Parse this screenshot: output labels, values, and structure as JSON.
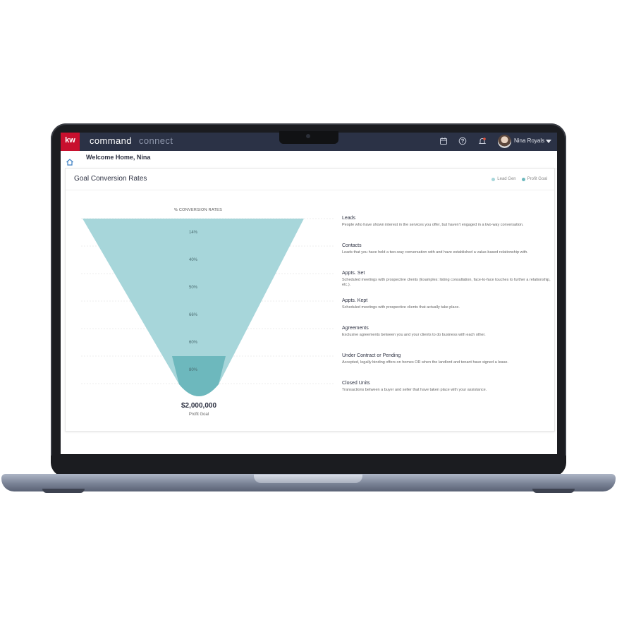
{
  "app": {
    "logo_text": "kw",
    "brand_primary": "command",
    "brand_secondary": "connect",
    "user_name": "Nina Royals",
    "colors": {
      "topbar": "#2b3246",
      "logo_red": "#c8102e",
      "funnel_light": "#a7d6da",
      "funnel_dark": "#6db8bd"
    }
  },
  "topbar_icons": [
    "calendar-icon",
    "help-icon",
    "bell-icon"
  ],
  "header": {
    "welcome": "Welcome Home, Nina"
  },
  "card": {
    "title": "Goal Conversion Rates",
    "legend": [
      {
        "label": "Lead Gen",
        "color": "#a7d6da"
      },
      {
        "label": "Profit Goal",
        "color": "#6db8bd"
      }
    ],
    "funnel_heading": "% CONVERSION RATES",
    "rates": [
      "14%",
      "40%",
      "50%",
      "66%",
      "60%",
      "80%"
    ],
    "profit_amount": "$2,000,000",
    "profit_label": "Profit Goal"
  },
  "stages": [
    {
      "title": "Leads",
      "desc": "People who have shown interest in the services you offer, but haven't engaged in a two-way conversation."
    },
    {
      "title": "Contacts",
      "desc": "Leads that you have held a two-way conversation with and have established a value-based relationship with."
    },
    {
      "title": "Appts. Set",
      "desc": "Scheduled meetings with prospective clients (Examples: listing consultation, face-to-face touches to further a relationship, etc.)."
    },
    {
      "title": "Appts. Kept",
      "desc": "Scheduled meetings with prospective clients that actually take place."
    },
    {
      "title": "Agreements",
      "desc": "Exclusive agreements between you and your clients to do business with each other."
    },
    {
      "title": "Under Contract or Pending",
      "desc": "Accepted, legally binding offers on homes OR when the landlord and tenant have signed a lease."
    },
    {
      "title": "Closed Units",
      "desc": "Transactions between a buyer and seller that have taken place with your assistance."
    }
  ]
}
